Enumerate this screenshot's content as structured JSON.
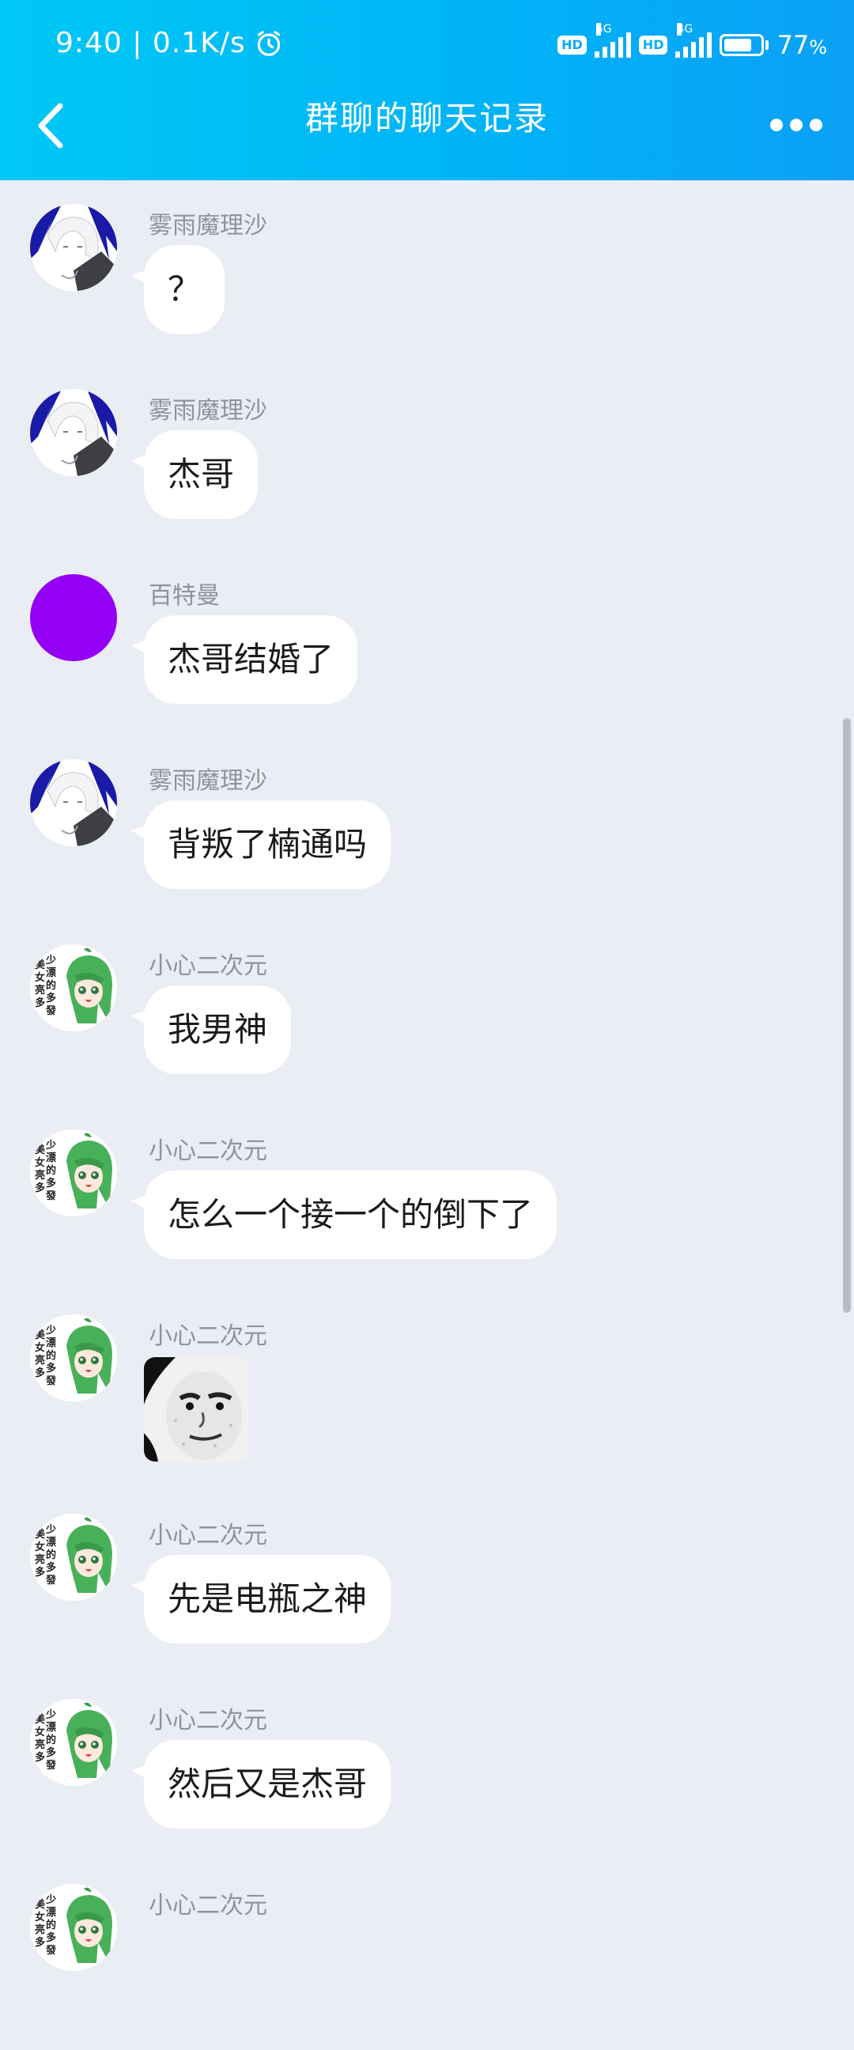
{
  "status_bar": {
    "time": "9:40 | 0.1K/s",
    "hd1": "HD",
    "net1": "5G",
    "hd2": "HD",
    "net2": "4G",
    "battery_percent": "77",
    "battery_unit": "%",
    "battery_level": 0.77
  },
  "header": {
    "title": "群聊的聊天记录"
  },
  "messages": [
    {
      "sender": "雾雨魔理沙",
      "text": "？",
      "avatar": "white-hair-avatar"
    },
    {
      "sender": "雾雨魔理沙",
      "text": "杰哥",
      "avatar": "white-hair-avatar"
    },
    {
      "sender": "百特曼",
      "text": "杰哥结婚了",
      "avatar": "purple-circle-avatar"
    },
    {
      "sender": "雾雨魔理沙",
      "text": "背叛了楠通吗",
      "avatar": "white-hair-avatar"
    },
    {
      "sender": "小心二次元",
      "text": "我男神",
      "avatar": "green-hair-avatar"
    },
    {
      "sender": "小心二次元",
      "text": "怎么一个接一个的倒下了",
      "avatar": "green-hair-avatar"
    },
    {
      "sender": "小心二次元",
      "text": "",
      "avatar": "green-hair-avatar",
      "sticker": "panda-face-sticker"
    },
    {
      "sender": "小心二次元",
      "text": "先是电瓶之神",
      "avatar": "green-hair-avatar"
    },
    {
      "sender": "小心二次元",
      "text": "然后又是杰哥",
      "avatar": "green-hair-avatar"
    },
    {
      "sender": "小心二次元",
      "text": "",
      "avatar": "green-hair-avatar"
    }
  ],
  "avatar_text": "美少女漂亮的多多發點",
  "colors": {
    "header_start": "#00c8f6",
    "header_end": "#0ba0f5",
    "background": "#ebedf4",
    "bubble": "#ffffff",
    "purple_avatar": "#9400f5"
  }
}
